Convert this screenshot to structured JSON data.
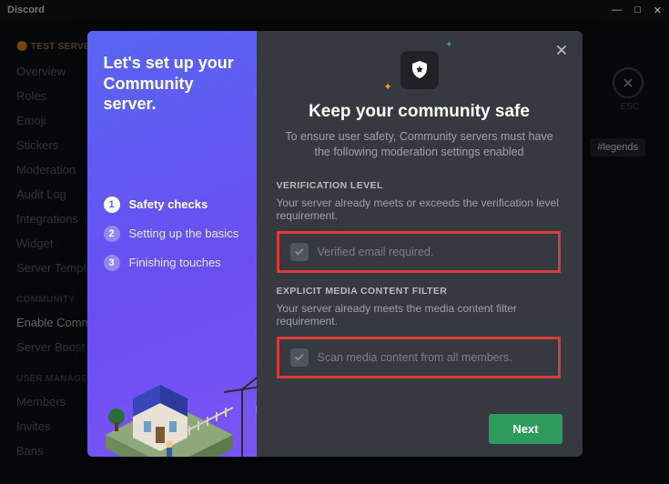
{
  "app": {
    "name": "Discord"
  },
  "window_controls": {
    "min": "—",
    "max": "□",
    "close": "✕"
  },
  "bg_settings": {
    "guild_label": "🟠 TEST SERVER",
    "items_a": [
      "Overview",
      "Roles",
      "Emoji",
      "Stickers",
      "Moderation",
      "Audit Log",
      "Integrations",
      "Widget",
      "Server Templa..."
    ],
    "section_community": "COMMUNITY",
    "items_b": [
      "Enable Commu...",
      "Server Boost S..."
    ],
    "section_user": "USER MANAGEM...",
    "items_c": [
      "Members",
      "Invites",
      "Bans"
    ],
    "close_label": "ESC",
    "pill": "#legends"
  },
  "modal": {
    "left": {
      "heading": "Let's set up your Community server.",
      "steps": [
        {
          "n": "1",
          "label": "Safety checks",
          "current": true
        },
        {
          "n": "2",
          "label": "Setting up the basics",
          "current": false
        },
        {
          "n": "3",
          "label": "Finishing touches",
          "current": false
        }
      ]
    },
    "right": {
      "title": "Keep your community safe",
      "subtitle": "To ensure user safety, Community servers must have the following moderation settings enabled",
      "sections": [
        {
          "title": "VERIFICATION LEVEL",
          "desc": "Your server already meets or exceeds the verification level requirement.",
          "checkbox_label": "Verified email required."
        },
        {
          "title": "EXPLICIT MEDIA CONTENT FILTER",
          "desc": "Your server already meets the media content filter requirement.",
          "checkbox_label": "Scan media content from all members."
        }
      ],
      "next_button": "Next"
    }
  }
}
